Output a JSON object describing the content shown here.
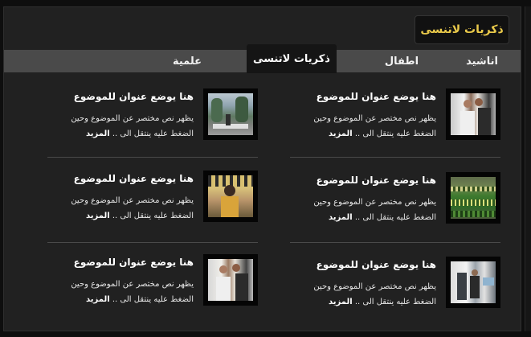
{
  "header": {
    "title": "ذكريات لاتنسى"
  },
  "tabs": [
    {
      "label": "اناشيد",
      "active": false
    },
    {
      "label": "اطفال",
      "active": false
    },
    {
      "label": "ذكريات لاتنسى",
      "active": true
    },
    {
      "label": "علمية",
      "active": false
    }
  ],
  "items": [
    {
      "title": "هنا يوضع عنوان للموضوع",
      "desc": "يظهر نص مختصر عن الموضوع وحين الضغط عليه ينتقل الى .. ",
      "more": "المزيد",
      "image": "people-photo"
    },
    {
      "title": "هنا يوضع عنوان للموضوع",
      "desc": "يظهر نص مختصر عن الموضوع وحين الضغط عليه ينتقل الى .. ",
      "more": "المزيد",
      "image": "street-photo"
    },
    {
      "title": "هنا يوضع عنوان للموضوع",
      "desc": "يظهر نص مختصر عن الموضوع وحين الضغط عليه ينتقل الى .. ",
      "more": "المزيد",
      "image": "stadium-photo"
    },
    {
      "title": "هنا يوضع عنوان للموضوع",
      "desc": "يظهر نص مختصر عن الموضوع وحين الضغط عليه ينتقل الى .. ",
      "more": "المزيد",
      "image": "crowd-photo"
    },
    {
      "title": "هنا يوضع عنوان للموضوع",
      "desc": "يظهر نص مختصر عن الموضوع وحين الضغط عليه ينتقل الى .. ",
      "more": "المزيد",
      "image": "hall-photo"
    },
    {
      "title": "هنا يوضع عنوان للموضوع",
      "desc": "يظهر نص مختصر عن الموضوع وحين الضغط عليه ينتقل الى .. ",
      "more": "المزيد",
      "image": "people-photo"
    }
  ]
}
